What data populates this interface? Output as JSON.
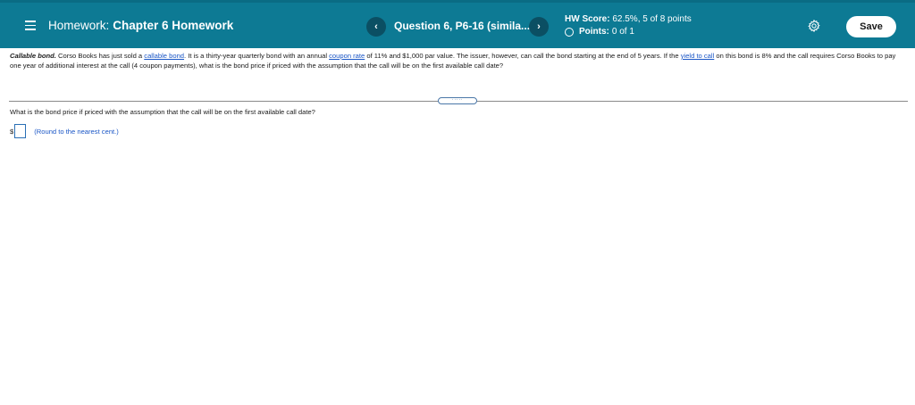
{
  "header": {
    "homework_label": "Homework:",
    "chapter": "Chapter 6 Homework",
    "question_title": "Question 6, P6-16 (simila...",
    "prev_symbol": "‹",
    "next_symbol": "›",
    "score_label": "HW Score:",
    "score_value": "62.5%, 5 of 8 points",
    "points_label": "Points:",
    "points_value": "0 of 1",
    "save_label": "Save",
    "bar_color": "#0d7a94"
  },
  "problem": {
    "lead": "Callable bond.",
    "t1": " Corso Books has just sold a ",
    "link1": "callable bond",
    "t2": ". It is a thirty-year quarterly bond with an annual ",
    "link2": "coupon rate",
    "t3": " of 11% and $1,000 par value. The issuer, however, can call the bond starting at the end of 5 years. If the ",
    "link3": "yield to call",
    "t4": " on this bond is 8% and the call requires Corso Books to pay one year of additional interest at the call (4 coupon payments), what is the bond price if priced with the assumption that the call will be on the first available call date?"
  },
  "question": {
    "prompt": "What is the bond price if priced with the assumption that the call will be on the first available call date?",
    "currency": "$",
    "answer_value": "",
    "hint": "(Round to the nearest cent.)"
  },
  "icons": {
    "menu": "menu-icon",
    "settings": "gear-icon",
    "status": "circle-icon"
  }
}
